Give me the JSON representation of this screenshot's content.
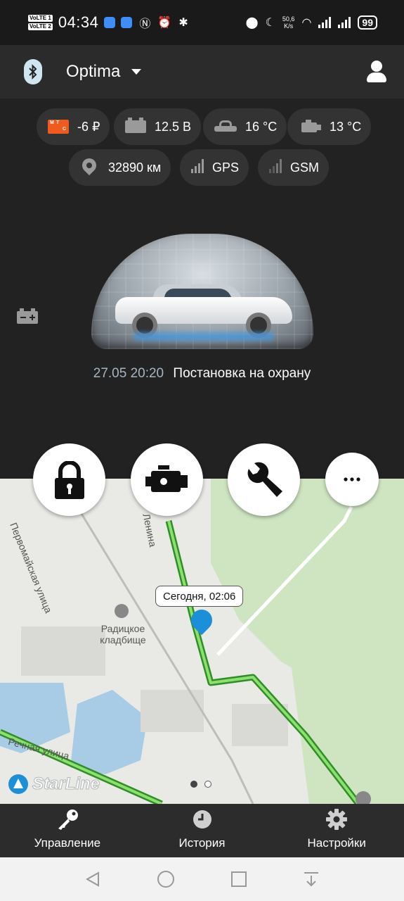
{
  "status_bar": {
    "volte_1": "VoLTE 1",
    "volte_2": "VoLTE 2",
    "time": "04:34",
    "net_speed_value": "50,6",
    "net_speed_unit": "K/s",
    "battery": "99"
  },
  "header": {
    "title": "Optima",
    "icons": [
      "bluetooth-icon",
      "chevron-down-icon",
      "user-icon"
    ]
  },
  "chips": {
    "balance": "-6 ₽",
    "voltage": "12.5 В",
    "cabin_temp": "16 °C",
    "engine_temp": "13 °C",
    "mileage": "32890 км",
    "gps": "GPS",
    "gsm": "GSM",
    "operator_logo": "МТС"
  },
  "last_event": {
    "time": "27.05 20:20",
    "text": "Постановка на охрану"
  },
  "actions": [
    "lock-button",
    "engine-button",
    "service-button",
    "more-button"
  ],
  "map": {
    "street_1": "Первомайская улица",
    "street_2": "Ленина",
    "poi": "Радицкое кладбище",
    "street_3": "Речная улица",
    "car_bubble": "Сегодня, 02:06",
    "watermark": "StarLine",
    "page_count": 2,
    "active_page": 1
  },
  "bottom_nav": {
    "items": [
      {
        "label": "Управление",
        "icon": "key-icon"
      },
      {
        "label": "История",
        "icon": "clock-icon"
      },
      {
        "label": "Настройки",
        "icon": "gear-icon"
      }
    ]
  },
  "colors": {
    "background": "#222222",
    "accent_blue": "#1b8fd8",
    "mts_orange": "#ef5a1e",
    "route_green": "#47b83a"
  }
}
